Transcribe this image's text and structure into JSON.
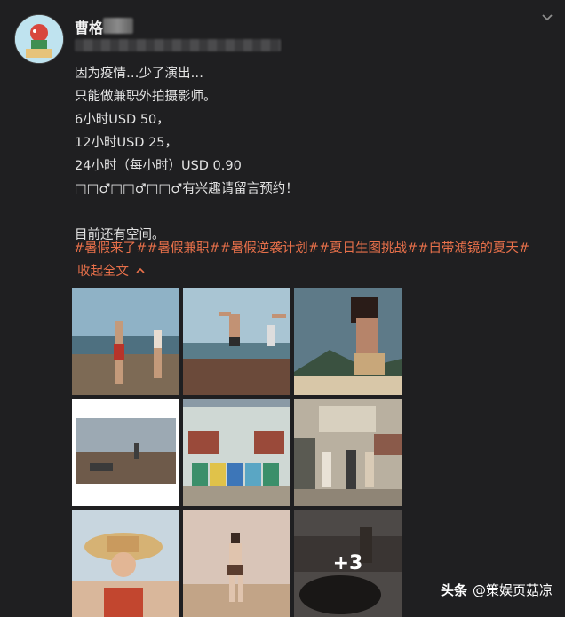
{
  "post": {
    "username": "曹格",
    "text_lines": [
      "因为疫情…少了演出…",
      "只能做兼职外拍摄影师。",
      "6小时USD 50，",
      "12小时USD 25，",
      "24小时（每小时）USD 0.90",
      "□□♂□□♂□□♂有兴趣请留言预约！",
      "",
      "目前还有空间。"
    ],
    "hashtags": "#暑假来了##暑假兼职##暑假逆袭计划##夏日生图挑战##自带滤镜的夏天#",
    "collapse_label": "收起全文",
    "more_count": "+3"
  },
  "icons": {
    "menu": "chevron-down-icon",
    "collapse": "chevron-up-icon"
  },
  "watermark": {
    "brand": "头条",
    "account": "@策娱页菇凉"
  },
  "colors": {
    "background": "#1f1f21",
    "accent": "#e8704a",
    "text": "#e3e3e3"
  }
}
